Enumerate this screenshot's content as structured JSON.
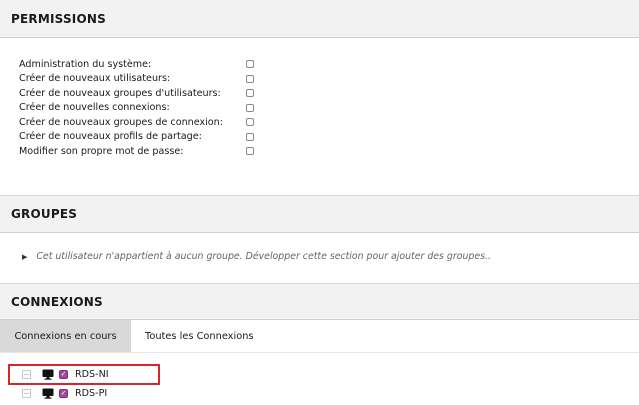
{
  "permissions": {
    "title": "PERMISSIONS",
    "items": [
      {
        "label": "Administration du système:",
        "checked": false
      },
      {
        "label": "Créer de nouveaux utilisateurs:",
        "checked": false
      },
      {
        "label": "Créer de nouveaux groupes d'utilisateurs:",
        "checked": false
      },
      {
        "label": "Créer de nouvelles connexions:",
        "checked": false
      },
      {
        "label": "Créer de nouveaux groupes de connexion:",
        "checked": false
      },
      {
        "label": "Créer de nouveaux profils de partage:",
        "checked": false
      },
      {
        "label": "Modifier son propre mot de passe:",
        "checked": false
      }
    ]
  },
  "groups": {
    "title": "GROUPES",
    "message": "Cet utilisateur n'appartient à aucun groupe. Développer cette section pour ajouter des groupes.."
  },
  "connections": {
    "title": "CONNEXIONS",
    "tabs": [
      {
        "label": "Connexions en cours",
        "active": true
      },
      {
        "label": "Toutes les Connexions",
        "active": false
      }
    ],
    "items": [
      {
        "name": "RDS-NI",
        "icon": "monitor-icon",
        "checked": true,
        "highlighted": true
      },
      {
        "name": "RDS-PI",
        "icon": "monitor-icon",
        "checked": true,
        "highlighted": false
      }
    ]
  },
  "colors": {
    "header_bg": "#f2f2f2",
    "active_tab_bg": "#d9d9d9",
    "checkbox_purple": "#a447a8",
    "highlight_red": "#d9262b"
  }
}
